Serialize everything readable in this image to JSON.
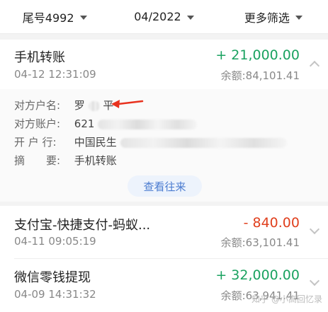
{
  "filters": {
    "account": "尾号4992",
    "month": "04/2022",
    "more": "更多筛选"
  },
  "transactions": [
    {
      "title": "手机转账",
      "time": "04-12 12:31:09",
      "amount": "+ 21,000.00",
      "balance": "余额:84,101.41",
      "expanded": true
    },
    {
      "title": "支付宝-快捷支付-蚂蚁...",
      "time": "04-11 09:05:19",
      "amount": "- 840.00",
      "balance": "余额:63,101.41",
      "expanded": false
    },
    {
      "title": "微信零钱提现",
      "time": "04-09 14:31:32",
      "amount": "+ 32,000.00",
      "balance": "余额:63,941.41",
      "expanded": false
    }
  ],
  "detail": {
    "counterparty_label": "对方户名:",
    "counterparty_first": "罗",
    "counterparty_last": "平",
    "account_label": "对方账户:",
    "account_prefix": "621",
    "bank_label": "开 户 行:",
    "bank_prefix": "中国民生",
    "memo_label": "摘　　要:",
    "memo_value": "手机转账",
    "view_button": "查看往来"
  },
  "colors": {
    "income": "#1aa260",
    "expense": "#e0401e",
    "annotation_arrow": "#e8321e",
    "button_text": "#4a7bd0"
  },
  "watermark": "知乎 @小高回忆录"
}
